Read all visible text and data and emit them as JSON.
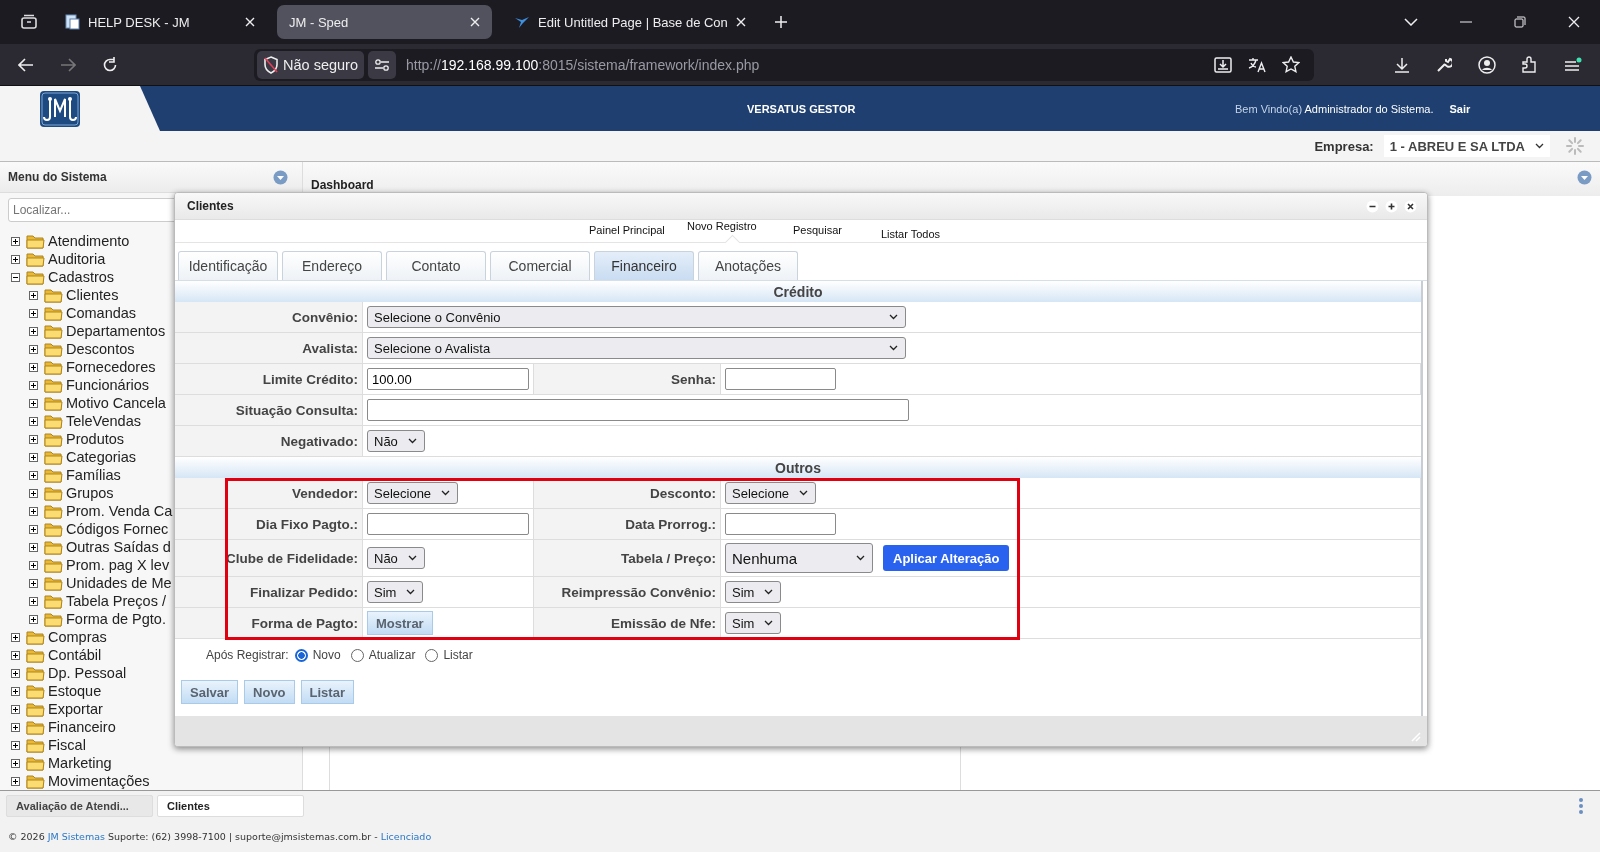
{
  "browser": {
    "tabs": [
      {
        "title": "HELP DESK - JM",
        "selected": false
      },
      {
        "title": "JM - Sped",
        "selected": true
      },
      {
        "title": "Edit Untitled Page | Base de Con",
        "selected": false
      }
    ],
    "security": "Não seguro",
    "url": {
      "scheme": "http://",
      "host": "192.168.99.100",
      "path": ":8015/sistema/framework/index.php"
    }
  },
  "header": {
    "title": "VERSATUS GESTOR",
    "welcome": "Bem Vindo(a)",
    "user": "Administrador do Sistema.",
    "logout": "Sair"
  },
  "company": {
    "label": "Empresa:",
    "value": "1 - ABREU E SA LTDA"
  },
  "sidebar": {
    "title": "Menu do Sistema",
    "search_placeholder": "Localizar...",
    "tree": [
      {
        "label": "Atendimento",
        "expanded": false
      },
      {
        "label": "Auditoria",
        "expanded": false
      },
      {
        "label": "Cadastros",
        "expanded": true,
        "children": [
          {
            "label": "Clientes",
            "expanded": false
          },
          {
            "label": "Comandas",
            "expanded": false
          },
          {
            "label": "Departamentos",
            "expanded": false
          },
          {
            "label": "Descontos",
            "expanded": false
          },
          {
            "label": "Fornecedores",
            "expanded": false
          },
          {
            "label": "Funcionários",
            "expanded": false
          },
          {
            "label": "Motivo Cancela",
            "expanded": false
          },
          {
            "label": "TeleVendas",
            "expanded": false
          },
          {
            "label": "Produtos",
            "expanded": false
          },
          {
            "label": "Categorias",
            "expanded": false
          },
          {
            "label": "Famílias",
            "expanded": false
          },
          {
            "label": "Grupos",
            "expanded": false
          },
          {
            "label": "Prom. Venda Ca",
            "expanded": false
          },
          {
            "label": "Códigos Fornec",
            "expanded": false
          },
          {
            "label": "Outras Saídas d",
            "expanded": false
          },
          {
            "label": "Prom. pag X lev",
            "expanded": false
          },
          {
            "label": "Unidades de Me",
            "expanded": false
          },
          {
            "label": "Tabela Preços /",
            "expanded": false
          },
          {
            "label": "Forma de Pgto.",
            "expanded": false
          }
        ]
      },
      {
        "label": "Compras",
        "expanded": false
      },
      {
        "label": "Contábil",
        "expanded": false
      },
      {
        "label": "Dp. Pessoal",
        "expanded": false
      },
      {
        "label": "Estoque",
        "expanded": false
      },
      {
        "label": "Exportar",
        "expanded": false
      },
      {
        "label": "Financeiro",
        "expanded": false
      },
      {
        "label": "Fiscal",
        "expanded": false
      },
      {
        "label": "Marketing",
        "expanded": false
      },
      {
        "label": "Movimentações",
        "expanded": false
      }
    ]
  },
  "main": {
    "title": "Dashboard"
  },
  "dialog": {
    "title": "Clientes",
    "nav": [
      {
        "label": "Painel Principal",
        "selected": false
      },
      {
        "label": "Novo Registro",
        "selected": true
      },
      {
        "label": "Pesquisar",
        "selected": false
      },
      {
        "label": "Listar Todos",
        "selected": false
      }
    ],
    "tabs": [
      {
        "label": "Identificação",
        "selected": false
      },
      {
        "label": "Endereço",
        "selected": false
      },
      {
        "label": "Contato",
        "selected": false
      },
      {
        "label": "Comercial",
        "selected": false
      },
      {
        "label": "Financeiro",
        "selected": true
      },
      {
        "label": "Anotações",
        "selected": false
      }
    ],
    "sections": [
      {
        "title": "Crédito",
        "highlight": false,
        "rows": [
          [
            {
              "label": "Convênio:",
              "kind": "select",
              "value": "Selecione o Convênio",
              "wide": true
            }
          ],
          [
            {
              "label": "Avalista:",
              "kind": "select",
              "value": "Selecione o Avalista",
              "wide": true
            }
          ],
          [
            {
              "label": "Limite Crédito:",
              "kind": "input",
              "value": "100.00",
              "wide": false
            },
            {
              "label": "Senha:",
              "kind": "input",
              "wide": false
            }
          ],
          [
            {
              "label": "Situação Consulta:",
              "kind": "input",
              "wide": true
            }
          ],
          [
            {
              "label": "Negativado:",
              "kind": "select",
              "value": "Não",
              "wide": false
            }
          ]
        ]
      },
      {
        "title": "Outros",
        "highlight": true,
        "rows": [
          [
            {
              "label": "Vendedor:",
              "kind": "select",
              "value": "Selecione",
              "wide": false
            },
            {
              "label": "Desconto:",
              "kind": "select",
              "value": "Selecione",
              "wide": false
            }
          ],
          [
            {
              "label": "Dia Fixo Pagto.:",
              "kind": "input",
              "wide": false
            },
            {
              "label": "Data Prorrog.:",
              "kind": "input",
              "wide": false
            }
          ],
          [
            {
              "label": "Clube de Fidelidade:",
              "kind": "select",
              "value": "Não",
              "wide": false
            },
            {
              "label": "Tabela / Preço:",
              "kind": "select",
              "value": "Nenhuma",
              "wide": false,
              "action": "Aplicar Alteração"
            }
          ],
          [
            {
              "label": "Finalizar Pedido:",
              "kind": "select",
              "value": "Sim",
              "wide": false
            },
            {
              "label": "Reimpressão Convênio:",
              "kind": "select",
              "value": "Sim",
              "wide": false
            }
          ],
          [
            {
              "label": "Forma de Pagto:",
              "kind": "button",
              "value": "Mostrar",
              "wide": false
            },
            {
              "label": "Emissão de Nfe:",
              "kind": "select",
              "value": "Sim",
              "wide": false
            }
          ]
        ]
      }
    ],
    "after_save": {
      "label": "Após Registrar:",
      "options": [
        {
          "label": "Novo",
          "selected": true
        },
        {
          "label": "Atualizar",
          "selected": false
        },
        {
          "label": "Listar",
          "selected": false
        }
      ]
    },
    "buttons": [
      "Salvar",
      "Novo",
      "Listar"
    ]
  },
  "taskbar": [
    {
      "label": "Avaliação de Atendi...",
      "selected": false
    },
    {
      "label": "Clientes",
      "selected": true
    }
  ],
  "footer": {
    "copyright": "© 2026",
    "company_link": "JM Sistemas",
    "support": "Suporte: (62) 3998-7100 | suporte@jmsistemas.com.br -",
    "license_link": "Licenciado"
  }
}
